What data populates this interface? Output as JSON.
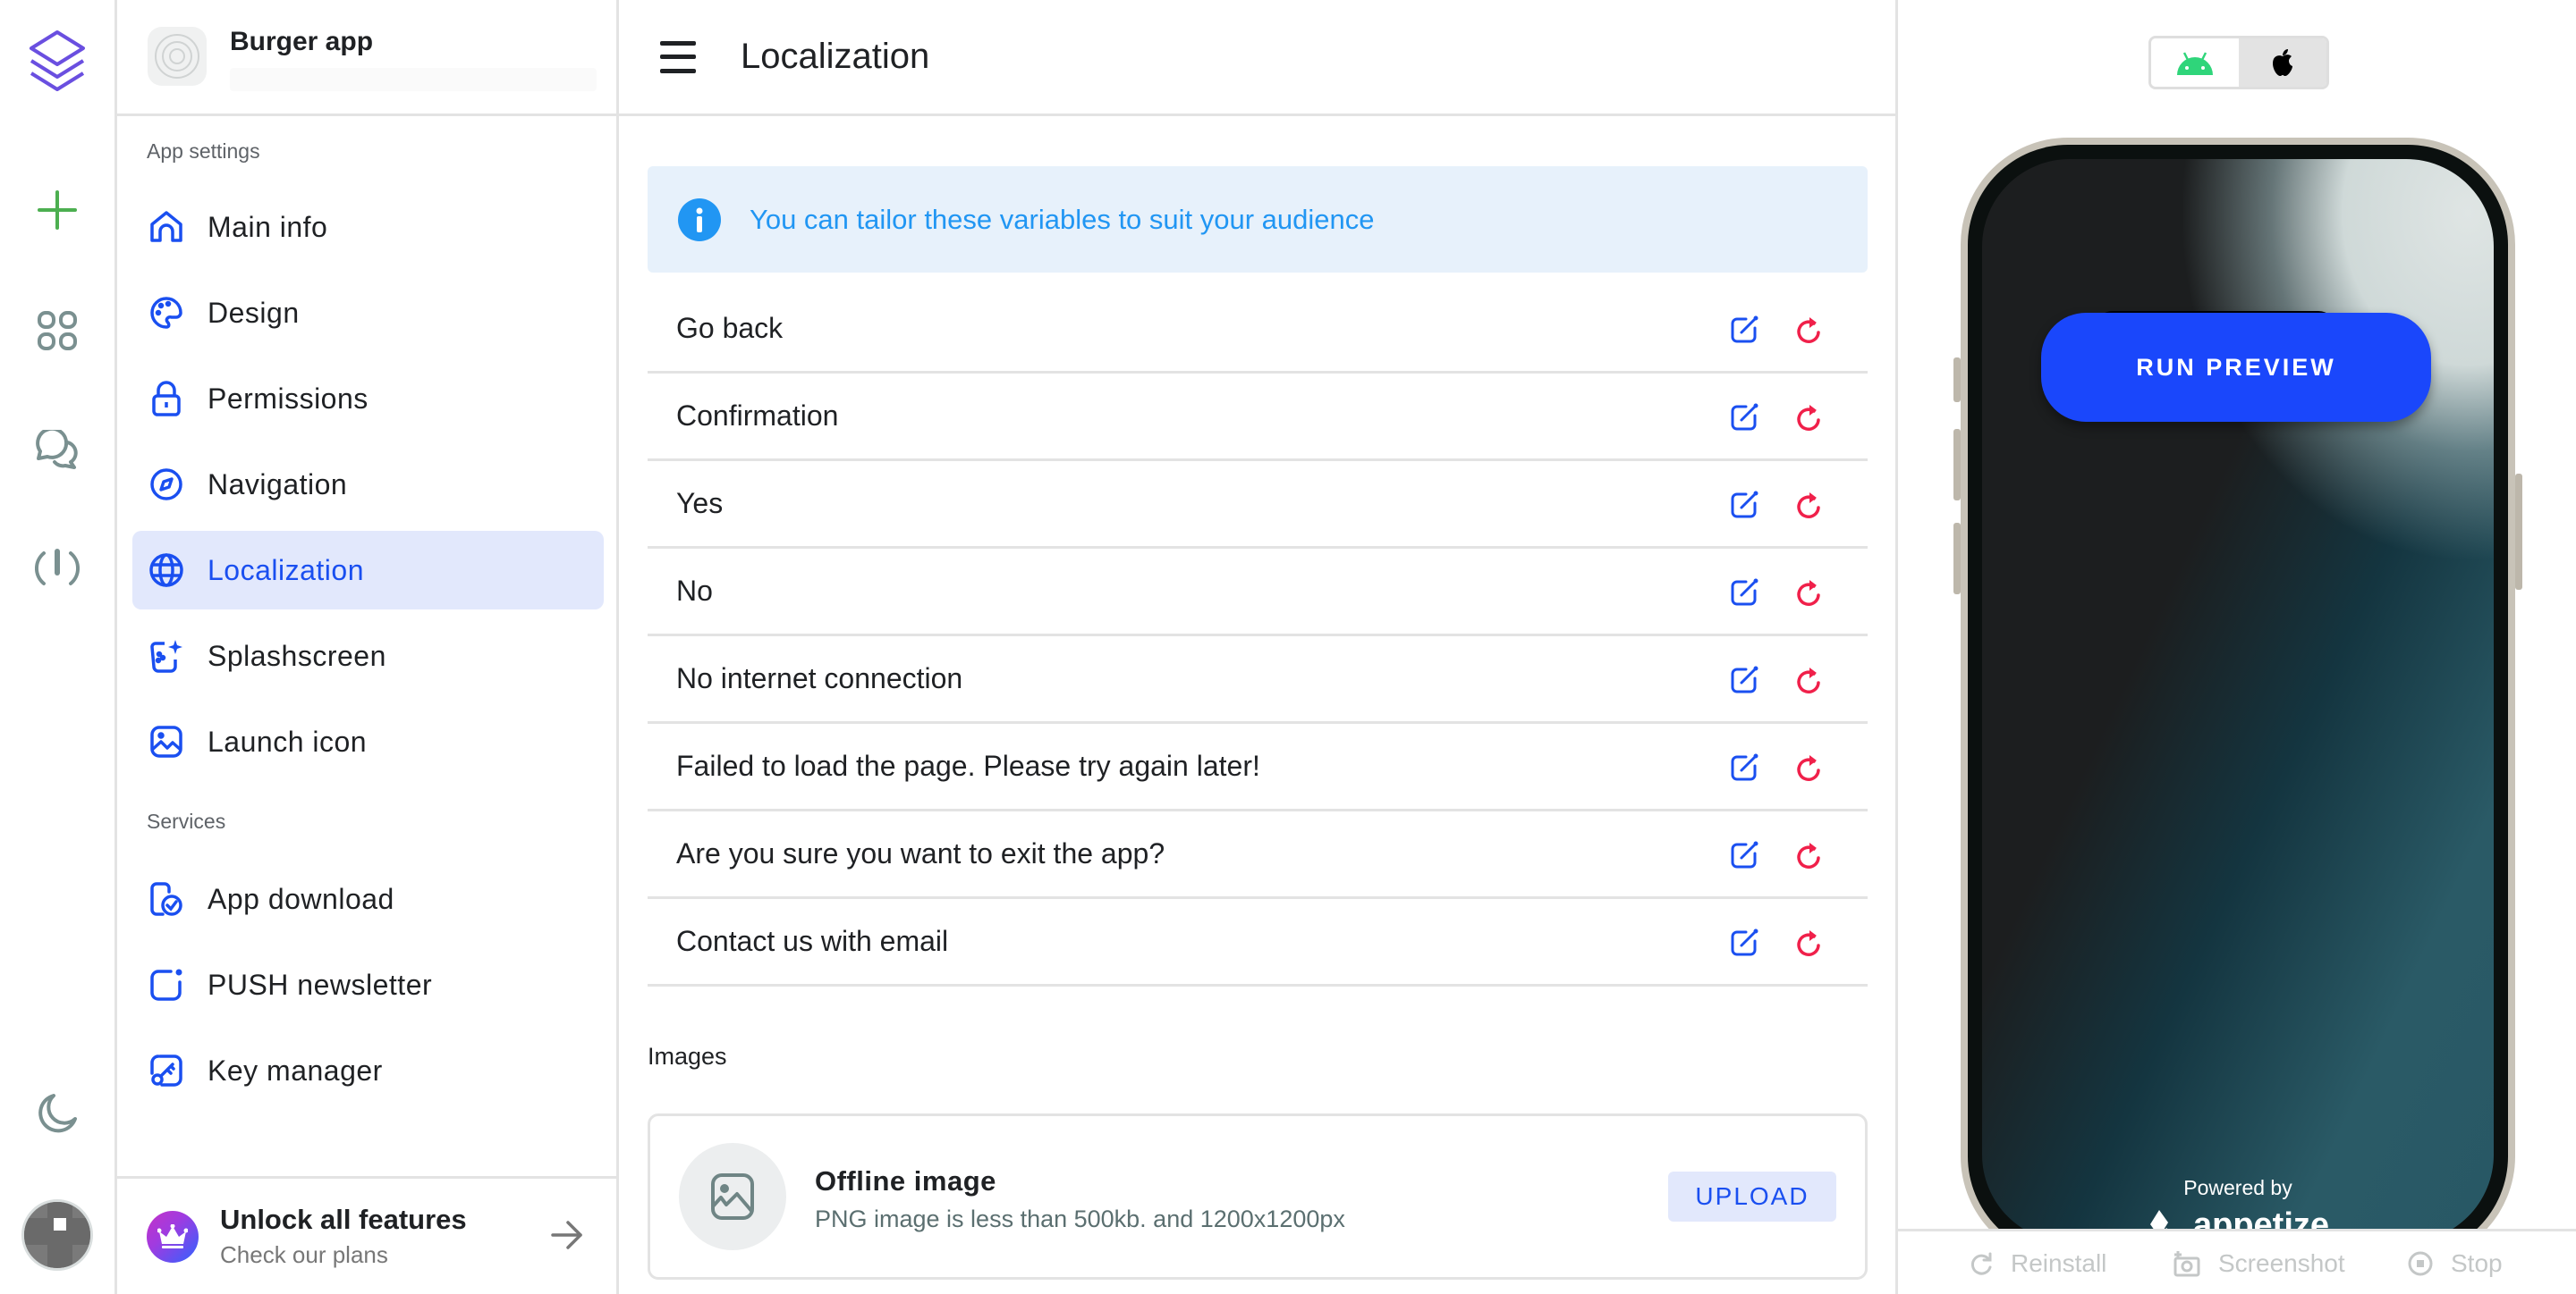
{
  "app": {
    "name": "Burger app"
  },
  "rail": {
    "items": [
      {
        "icon": "layers-icon"
      },
      {
        "icon": "plus-icon"
      },
      {
        "icon": "apps-grid-icon"
      },
      {
        "icon": "chat-icon"
      },
      {
        "icon": "speedometer-icon"
      },
      {
        "icon": "moon-icon"
      }
    ]
  },
  "sidebar": {
    "sections": [
      {
        "label": "App settings",
        "items": [
          {
            "label": "Main info",
            "icon": "home-icon"
          },
          {
            "label": "Design",
            "icon": "palette-icon"
          },
          {
            "label": "Permissions",
            "icon": "lock-icon"
          },
          {
            "label": "Navigation",
            "icon": "compass-icon"
          },
          {
            "label": "Localization",
            "icon": "globe-icon",
            "active": true
          },
          {
            "label": "Splashscreen",
            "icon": "splashscreen-icon"
          },
          {
            "label": "Launch icon",
            "icon": "image-icon"
          }
        ]
      },
      {
        "label": "Services",
        "items": [
          {
            "label": "App download",
            "icon": "app-download-icon"
          },
          {
            "label": "PUSH newsletter",
            "icon": "notification-icon"
          },
          {
            "label": "Key manager",
            "icon": "key-icon"
          }
        ]
      }
    ],
    "unlock": {
      "title": "Unlock all features",
      "subtitle": "Check our plans"
    }
  },
  "main": {
    "title": "Localization",
    "info": "You can tailor these variables to suit your audience",
    "variables": [
      {
        "label": "Go back"
      },
      {
        "label": "Confirmation"
      },
      {
        "label": "Yes"
      },
      {
        "label": "No"
      },
      {
        "label": "No internet connection"
      },
      {
        "label": "Failed to load the page. Please try again later!"
      },
      {
        "label": "Are you sure you want to exit the app?"
      },
      {
        "label": "Contact us with email"
      }
    ],
    "images_heading": "Images",
    "image_card": {
      "title": "Offline image",
      "description": "PNG image is less than 500kb. and 1200x1200px",
      "upload_label": "UPLOAD"
    }
  },
  "preview": {
    "os_options": [
      "Android",
      "iOS"
    ],
    "selected_os": "Android",
    "run_label": "RUN PREVIEW",
    "powered_by": "Powered by",
    "brand": "appetize",
    "actions": [
      {
        "label": "Reinstall",
        "icon": "reload-icon"
      },
      {
        "label": "Screenshot",
        "icon": "camera-icon"
      },
      {
        "label": "Stop",
        "icon": "stop-icon"
      }
    ]
  },
  "colors": {
    "accent": "#1a4ff0",
    "active_bg": "#e2e8fc",
    "info": "#2196f3",
    "reset": "#f0204a",
    "run_preview": "#1a47fb"
  }
}
